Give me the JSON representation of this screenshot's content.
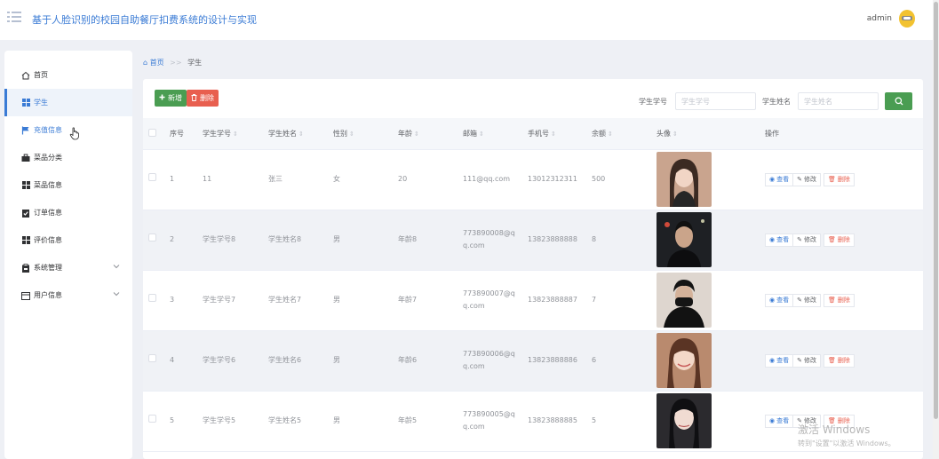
{
  "header": {
    "title": "基于人脸识别的校园自助餐厅扣费系统的设计与实现",
    "username": "admin"
  },
  "sidebar": {
    "items": [
      {
        "label": "首页",
        "icon": "home-icon"
      },
      {
        "label": "学生",
        "icon": "grid-icon"
      },
      {
        "label": "充值信息",
        "icon": "flag-icon"
      },
      {
        "label": "菜品分类",
        "icon": "briefcase-icon"
      },
      {
        "label": "菜品信息",
        "icon": "grid-icon"
      },
      {
        "label": "订单信息",
        "icon": "clipboard-check-icon"
      },
      {
        "label": "评价信息",
        "icon": "grid-icon"
      },
      {
        "label": "系统管理",
        "icon": "clipboard-icon"
      },
      {
        "label": "用户信息",
        "icon": "calendar-icon"
      }
    ]
  },
  "breadcrumb": {
    "home": "首页",
    "separator": ">>",
    "current": "学生"
  },
  "toolbar": {
    "add_label": "新增",
    "delete_label": "删除",
    "student_id_label": "学生学号",
    "student_id_placeholder": "学生学号",
    "student_name_label": "学生姓名",
    "student_name_placeholder": "学生姓名"
  },
  "table": {
    "headers": [
      "序号",
      "学生学号",
      "学生姓名",
      "性别",
      "年龄",
      "邮箱",
      "手机号",
      "余额",
      "头像",
      "操作"
    ],
    "actions": {
      "view": "查看",
      "edit": "修改",
      "delete": "删除"
    },
    "rows": [
      {
        "index": "1",
        "student_id": "11",
        "name": "张三",
        "gender": "女",
        "age": "20",
        "email_line1": "111@qq.com",
        "email_line2": "",
        "phone": "13012312311",
        "balance": "500"
      },
      {
        "index": "2",
        "student_id": "学生学号8",
        "name": "学生姓名8",
        "gender": "男",
        "age": "年龄8",
        "email_line1": "773890008@q",
        "email_line2": "q.com",
        "phone": "13823888888",
        "balance": "8"
      },
      {
        "index": "3",
        "student_id": "学生学号7",
        "name": "学生姓名7",
        "gender": "男",
        "age": "年龄7",
        "email_line1": "773890007@q",
        "email_line2": "q.com",
        "phone": "13823888887",
        "balance": "7"
      },
      {
        "index": "4",
        "student_id": "学生学号6",
        "name": "学生姓名6",
        "gender": "男",
        "age": "年龄6",
        "email_line1": "773890006@q",
        "email_line2": "q.com",
        "phone": "13823888886",
        "balance": "6"
      },
      {
        "index": "5",
        "student_id": "学生学号5",
        "name": "学生姓名5",
        "gender": "男",
        "age": "年龄5",
        "email_line1": "773890005@q",
        "email_line2": "q.com",
        "phone": "13823888885",
        "balance": "5"
      }
    ]
  },
  "watermark": {
    "line1": "激活 Windows",
    "line2": "转到\"设置\"以激活 Windows。"
  },
  "colors": {
    "primary": "#3a7bd5",
    "success": "#4a9d52",
    "danger": "#e85f4f"
  }
}
